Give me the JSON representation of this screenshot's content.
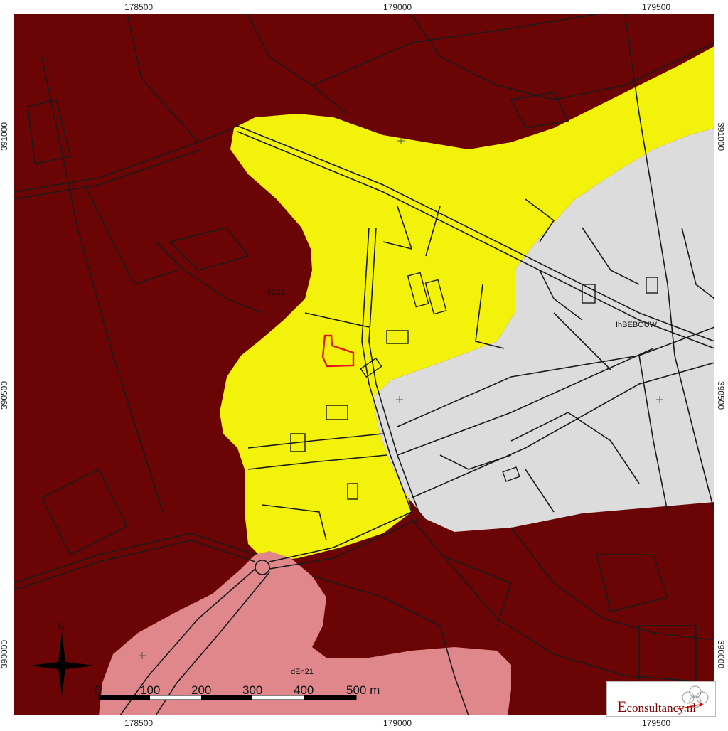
{
  "axes": {
    "x_ticks_top": [
      "178500",
      "179000",
      "179500"
    ],
    "x_ticks_bottom": [
      "178500",
      "179000",
      "179500"
    ],
    "y_ticks_left": [
      "391000",
      "390500",
      "390000"
    ],
    "y_ticks_right": [
      "391000",
      "390500",
      "390000"
    ]
  },
  "map_labels": {
    "zone_label_east": "IhBEBOUW",
    "zone_label_west": "dE21",
    "zone_label_south": "dEn21"
  },
  "north_arrow": {
    "label": "N"
  },
  "scale_bar": {
    "labels": [
      "0",
      "100",
      "200",
      "300",
      "400",
      "500 m"
    ]
  },
  "logo": {
    "text_cap": "E",
    "text_rest": "consultancy.nl"
  },
  "legend_colors": {
    "dark_zone": "#6b0505",
    "yellow_zone": "#f2f20a",
    "grey_zone": "#dcdcdc",
    "pink_zone": "#e0878c",
    "site_outline": "#e01818",
    "road_lines": "#1a1a1a"
  }
}
